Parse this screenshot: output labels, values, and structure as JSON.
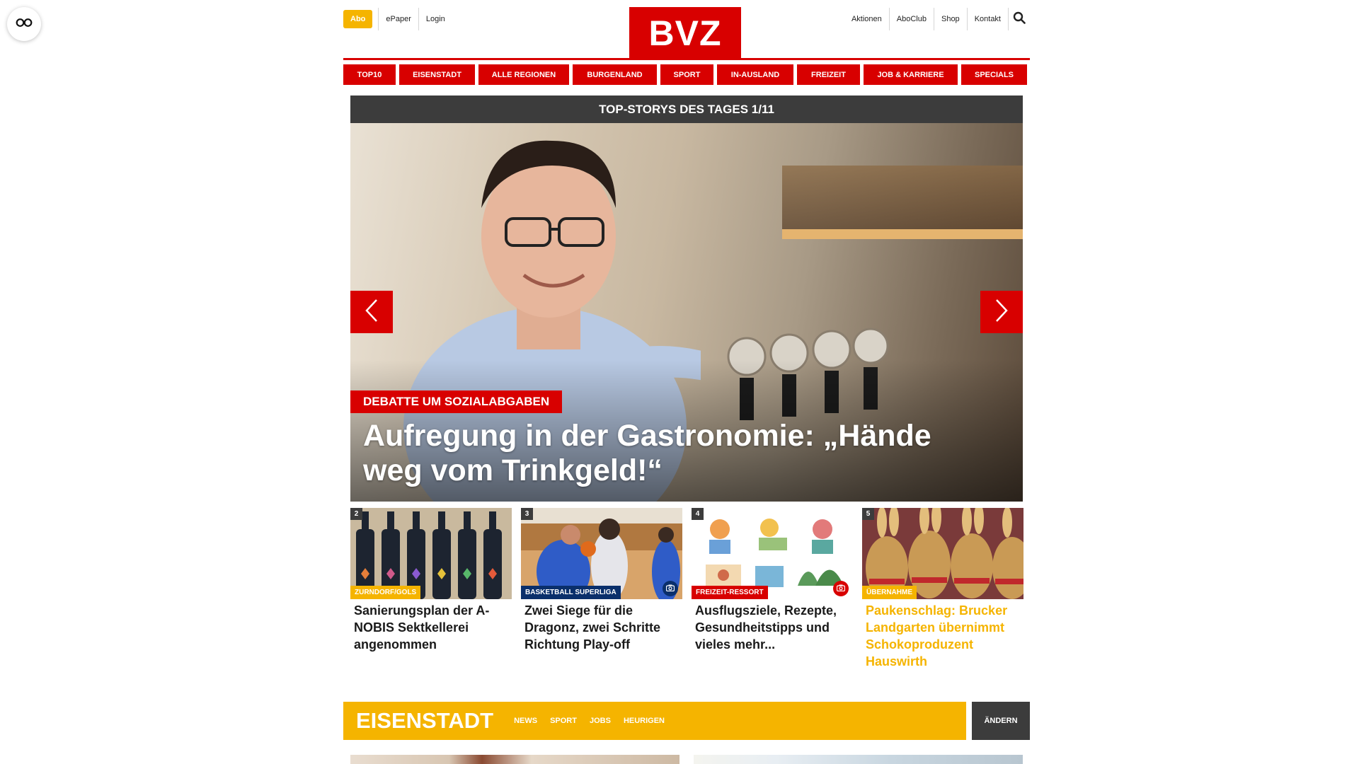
{
  "header": {
    "abo_label": "Abo",
    "left_links": [
      "ePaper",
      "Login"
    ],
    "logo_text": "BVZ",
    "right_links": [
      "Aktionen",
      "AboClub",
      "Shop",
      "Kontakt"
    ],
    "search_icon": "search-icon"
  },
  "colors": {
    "brand_red": "#d80000",
    "accent_yellow": "#f5b400",
    "dark_bar": "#3c3c3c"
  },
  "nav": {
    "items": [
      "TOP10",
      "EISENSTADT",
      "ALLE REGIONEN",
      "BURGENLAND",
      "SPORT",
      "IN-AUSLAND",
      "FREIZEIT",
      "JOB & KARRIERE",
      "SPECIALS"
    ]
  },
  "top_stories": {
    "heading": "TOP-STORYS DES TAGES 1/11",
    "hero": {
      "kicker": "DEBATTE UM SOZIALABGABEN",
      "title": "Aufregung in der Gastronomie: „Hände weg vom Trinkgeld!“"
    },
    "cards": [
      {
        "num": "2",
        "tag": "ZURNDORF/GOLS",
        "tag_color": "#f5b400",
        "title": "Sanierungsplan der A-NOBIS Sektkellerei angenommen",
        "highlight": false,
        "gallery": false
      },
      {
        "num": "3",
        "tag": "BASKETBALL SUPERLIGA",
        "tag_color": "#0a2f6b",
        "title": "Zwei Siege für die Dragonz, zwei Schritte Richtung Play-off",
        "highlight": false,
        "gallery": true
      },
      {
        "num": "4",
        "tag": "FREIZEIT-RESSORT",
        "tag_color": "#d80000",
        "title": "Ausflugsziele, Rezepte, Gesundheitstipps und vieles mehr...",
        "highlight": false,
        "gallery": true
      },
      {
        "num": "5",
        "tag": "ÜBERNAHME",
        "tag_color": "#f5b400",
        "title": "Paukenschlag: Brucker Landgarten übernimmt Schokoproduzent Hauswirth",
        "highlight": true,
        "gallery": false
      }
    ]
  },
  "region": {
    "name": "EISENSTADT",
    "links": [
      "NEWS",
      "SPORT",
      "JOBS",
      "HEURIGEN"
    ],
    "change_label": "ÄNDERN"
  }
}
